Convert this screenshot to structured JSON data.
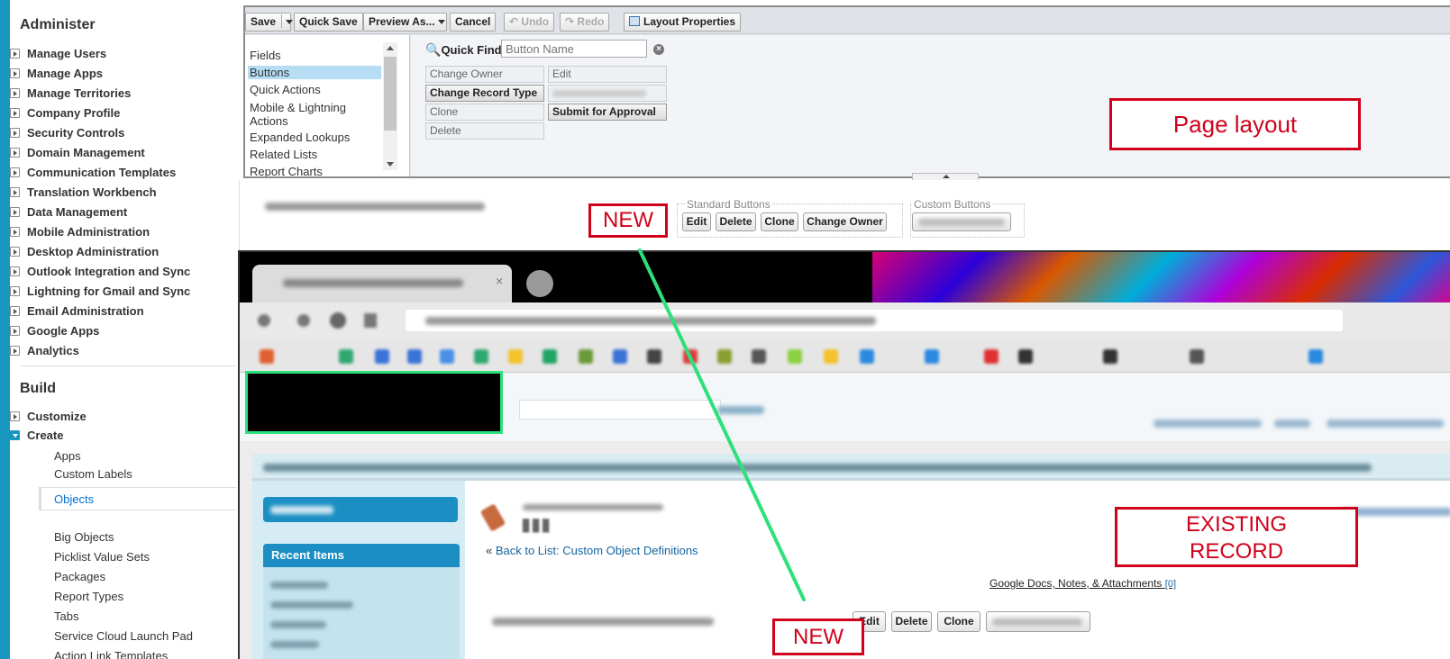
{
  "sidebar": {
    "administer_heading": "Administer",
    "administer_items": [
      "Manage Users",
      "Manage Apps",
      "Manage Territories",
      "Company Profile",
      "Security Controls",
      "Domain Management",
      "Communication Templates",
      "Translation Workbench",
      "Data Management",
      "Mobile Administration",
      "Desktop Administration",
      "Outlook Integration and Sync",
      "Lightning for Gmail and Sync",
      "Email Administration",
      "Google Apps",
      "Analytics"
    ],
    "build_heading": "Build",
    "customize": "Customize",
    "create": "Create",
    "create_children": [
      "Apps",
      "Custom Labels"
    ],
    "selected": "Objects",
    "build_more": [
      "Big Objects",
      "Picklist Value Sets",
      "Packages",
      "Report Types",
      "Tabs",
      "Service Cloud Launch Pad",
      "Action Link Templates"
    ]
  },
  "toolbar": {
    "save": "Save",
    "quick_save": "Quick Save",
    "preview_as": "Preview As...",
    "cancel": "Cancel",
    "undo": "Undo",
    "redo": "Redo",
    "layout_properties": "Layout Properties"
  },
  "palette": {
    "categories": [
      "Fields",
      "Buttons",
      "Quick Actions",
      "Mobile & Lightning Actions",
      "Expanded Lookups",
      "Related Lists",
      "Report Charts"
    ],
    "selected_category": "Buttons",
    "quick_find_label": "Quick Find",
    "quick_find_placeholder": "Button Name",
    "buttons_col1": [
      "Change Owner",
      "Change Record Type",
      "Clone",
      "Delete"
    ],
    "buttons_col2": [
      "Edit",
      "",
      "Submit for Approval"
    ]
  },
  "annotations": {
    "page_layout": "Page layout",
    "new_top": "NEW",
    "existing_record_line1": "EXISTING",
    "existing_record_line2": "RECORD",
    "new_bottom": "NEW"
  },
  "layout_buttons": {
    "standard_title": "Standard Buttons",
    "standard": [
      "Edit",
      "Delete",
      "Clone",
      "Change Owner"
    ],
    "custom_title": "Custom Buttons"
  },
  "record": {
    "recent_items": "Recent Items",
    "back_prefix": "« ",
    "back_link": "Back to List: Custom Object Definitions",
    "gdocs_link": "Google Docs, Notes, & Attachments",
    "gdocs_count": "[0]",
    "detail_buttons": [
      "Edit",
      "Delete",
      "Clone"
    ]
  },
  "colors": {
    "accent": "#1797c0",
    "annotation_red": "#d0021b",
    "arrow_green": "#2ee07c"
  }
}
